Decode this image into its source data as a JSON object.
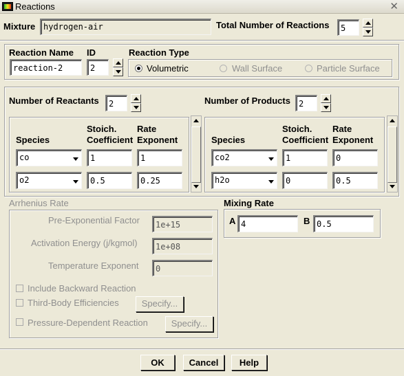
{
  "window": {
    "title": "Reactions",
    "close_glyph": "✕"
  },
  "mixture": {
    "label": "Mixture",
    "value": "hydrogen-air"
  },
  "total_reactions": {
    "label": "Total Number of Reactions",
    "value": "5"
  },
  "reaction_name": {
    "label": "Reaction Name",
    "value": "reaction-2"
  },
  "id": {
    "label": "ID",
    "value": "2"
  },
  "reaction_type": {
    "label": "Reaction Type",
    "options": [
      "Volumetric",
      "Wall Surface",
      "Particle Surface"
    ],
    "selected": "Volumetric"
  },
  "reactants": {
    "count_label": "Number of Reactants",
    "count": "2",
    "headers": {
      "species": "Species",
      "stoich": "Stoich.\nCoefficient",
      "rate": "Rate\nExponent"
    },
    "rows": [
      {
        "species": "co",
        "stoich": "1",
        "rate": "1"
      },
      {
        "species": "o2",
        "stoich": "0.5",
        "rate": "0.25"
      }
    ]
  },
  "products": {
    "count_label": "Number of Products",
    "count": "2",
    "headers": {
      "species": "Species",
      "stoich": "Stoich.\nCoefficient",
      "rate": "Rate\nExponent"
    },
    "rows": [
      {
        "species": "co2",
        "stoich": "1",
        "rate": "0"
      },
      {
        "species": "h2o",
        "stoich": "0",
        "rate": "0.5"
      }
    ]
  },
  "arrhenius": {
    "label": "Arrhenius Rate",
    "pre_exp_label": "Pre-Exponential Factor",
    "pre_exp_value": "1e+15",
    "activation_label": "Activation Energy (j/kgmol)",
    "activation_value": "1e+08",
    "temp_exp_label": "Temperature Exponent",
    "temp_exp_value": "0",
    "backward_label": "Include Backward Reaction",
    "third_body_label": "Third-Body Efficiencies",
    "pressure_label": "Pressure-Dependent Reaction",
    "specify_label": "Specify..."
  },
  "mixing": {
    "label": "Mixing Rate",
    "a_label": "A",
    "a_value": "4",
    "b_label": "B",
    "b_value": "0.5"
  },
  "buttons": {
    "ok": "OK",
    "cancel": "Cancel",
    "help": "Help"
  }
}
